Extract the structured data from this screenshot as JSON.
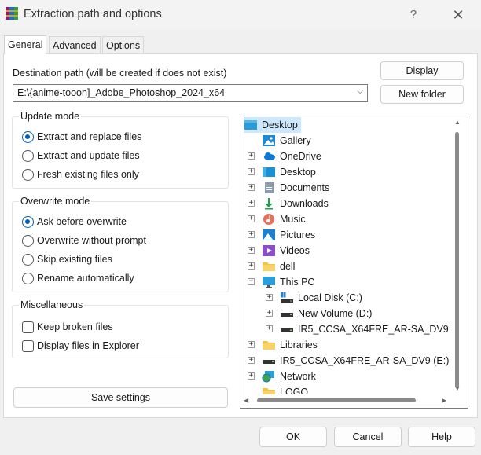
{
  "window": {
    "title": "Extraction path and options",
    "help_label": "?",
    "close_label": "✕"
  },
  "tabs": [
    "General",
    "Advanced",
    "Options"
  ],
  "destination": {
    "label": "Destination path (will be created if does not exist)",
    "value": "E:\\{anime-tooon]_Adobe_Photoshop_2024_x64",
    "display_button": "Display",
    "new_folder_button": "New folder"
  },
  "update_mode": {
    "title": "Update mode",
    "options": [
      "Extract and replace files",
      "Extract and update files",
      "Fresh existing files only"
    ],
    "selected": 0
  },
  "overwrite_mode": {
    "title": "Overwrite mode",
    "options": [
      "Ask before overwrite",
      "Overwrite without prompt",
      "Skip existing files",
      "Rename automatically"
    ],
    "selected": 0
  },
  "miscellaneous": {
    "title": "Miscellaneous",
    "options": [
      "Keep broken files",
      "Display files in Explorer"
    ]
  },
  "save_settings_button": "Save settings",
  "tree": {
    "items": [
      {
        "label": "Desktop",
        "icon": "desktop-icon"
      },
      {
        "label": "Gallery",
        "icon": "gallery-icon"
      },
      {
        "label": "OneDrive",
        "icon": "cloud-icon"
      },
      {
        "label": "Desktop",
        "icon": "desktop-folder-icon"
      },
      {
        "label": "Documents",
        "icon": "documents-icon"
      },
      {
        "label": "Downloads",
        "icon": "download-icon"
      },
      {
        "label": "Music",
        "icon": "music-icon"
      },
      {
        "label": "Pictures",
        "icon": "pictures-icon"
      },
      {
        "label": "Videos",
        "icon": "videos-icon"
      },
      {
        "label": "dell",
        "icon": "folder-icon"
      },
      {
        "label": "This PC",
        "icon": "computer-icon"
      },
      {
        "label": "Local Disk (C:)",
        "icon": "system-drive-icon"
      },
      {
        "label": "New Volume (D:)",
        "icon": "drive-icon"
      },
      {
        "label": "IR5_CCSA_X64FRE_AR-SA_DV9 (",
        "icon": "drive-icon"
      },
      {
        "label": "Libraries",
        "icon": "folder-icon"
      },
      {
        "label": "IR5_CCSA_X64FRE_AR-SA_DV9 (E:)",
        "icon": "drive-icon"
      },
      {
        "label": "Network",
        "icon": "network-icon"
      },
      {
        "label": "LOGO",
        "icon": "folder-icon"
      }
    ]
  },
  "footer": {
    "ok": "OK",
    "cancel": "Cancel",
    "help": "Help"
  },
  "colors": {
    "accent": "#005fb8",
    "selection": "#cce8ff"
  }
}
